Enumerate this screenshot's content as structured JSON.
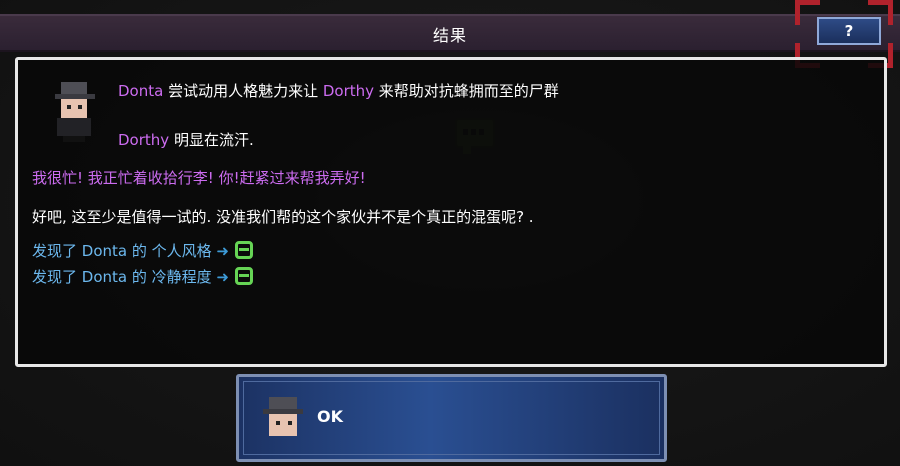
{
  "window": {
    "title": "结果"
  },
  "help_button": {
    "label": "?"
  },
  "dialog": {
    "line1": {
      "actor": "Donta",
      "text_a": " 尝试动用人格魅力来让 ",
      "target": "Dorthy",
      "text_b": " 来帮助对抗蜂拥而至的尸群"
    },
    "line2": {
      "actor": "Dorthy",
      "text": " 明显在流汗."
    },
    "quote": "我很忙! 我正忙着收拾行李! 你!赶紧过来帮我弄好!",
    "narration": "好吧, 这至少是值得一试的. 没准我们帮的这个家伙并不是个真正的混蛋呢? .",
    "discoveries": [
      {
        "prefix": "发现了 ",
        "name": "Donta",
        "trait": " 的 个人风格",
        "arrow": "➜",
        "icon": "green-face-icon"
      },
      {
        "prefix": "发现了 ",
        "name": "Donta",
        "trait": " 的 冷静程度",
        "arrow": "➜",
        "icon": "green-face-icon"
      }
    ]
  },
  "ok_button": {
    "label": "OK",
    "icon": "character-portrait-icon"
  },
  "colors": {
    "highlight_name": "#cc6cf0",
    "discovery": "#6cb8ee",
    "panel_border": "#e8e8e8",
    "button_blue": "#2a4f92",
    "corner_red": "#b0222c",
    "trait_icon": "#66d455"
  }
}
